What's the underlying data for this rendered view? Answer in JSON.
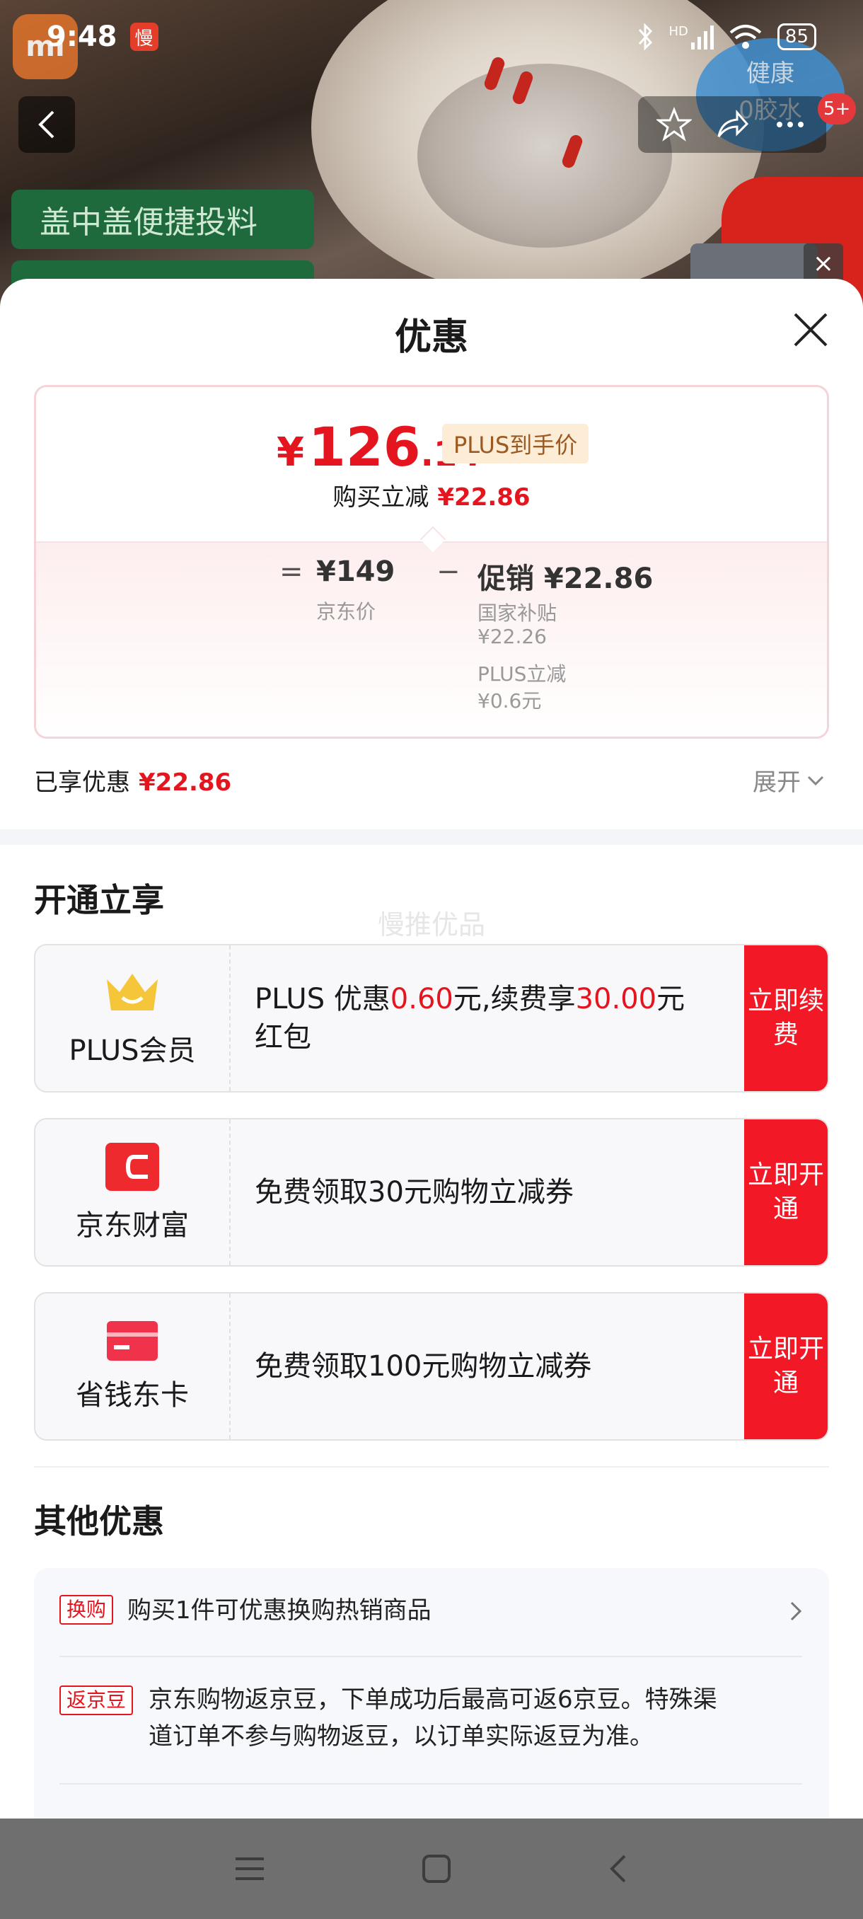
{
  "status_bar": {
    "time": "9:48",
    "app_badge": "慢",
    "network": "HD",
    "battery": "85"
  },
  "background": {
    "green_tag": "盖中盖便捷投料",
    "blue_badge_line1": "健康",
    "blue_badge_line2": "0胶水",
    "cart_count": "5+"
  },
  "sheet": {
    "title": "优惠",
    "price": {
      "currency": "¥",
      "integer": "126",
      "decimal": ".14",
      "tag": "PLUS到手价",
      "discount_label": "购买立减",
      "discount_value": "¥22.86"
    },
    "formula": {
      "eq": "=",
      "base_price": "¥149",
      "base_label": "京东价",
      "minus": "−",
      "promo": "促销 ¥22.86",
      "sub1_label": "国家补贴",
      "sub1_value": "¥22.26",
      "sub2_label": "PLUS立减",
      "sub2_value": "¥0.6元"
    },
    "enjoyed_label": "已享优惠",
    "enjoyed_value": "¥22.86",
    "expand_label": "展开",
    "open_section_title": "开通立享",
    "watermark": "慢推优品",
    "offers": [
      {
        "name": "PLUS会员",
        "text_a": "PLUS 优惠",
        "highlight_a": "0.60",
        "text_b": "元,续费享",
        "highlight_b": "30.00",
        "text_c": "元红包",
        "button": "立即续费"
      },
      {
        "name": "京东财富",
        "text": "免费领取30元购物立减券",
        "button": "立即开通"
      },
      {
        "name": "省钱东卡",
        "text": "免费领取100元购物立减券",
        "button": "立即开通"
      }
    ],
    "other_section_title": "其他优惠",
    "others": [
      {
        "tag": "换购",
        "text": "购买1件可优惠换购热销商品"
      },
      {
        "tag": "返京豆",
        "text_line1": "京东购物返京豆，下单成功后最高可返6京豆。特殊渠",
        "text_line2": "道订单不参与购物返豆，以订单实际返豆为准。"
      }
    ]
  },
  "colors": {
    "accent_red": "#e4151f",
    "button_red": "#f31825",
    "plus_gold": "#f5c63a"
  }
}
